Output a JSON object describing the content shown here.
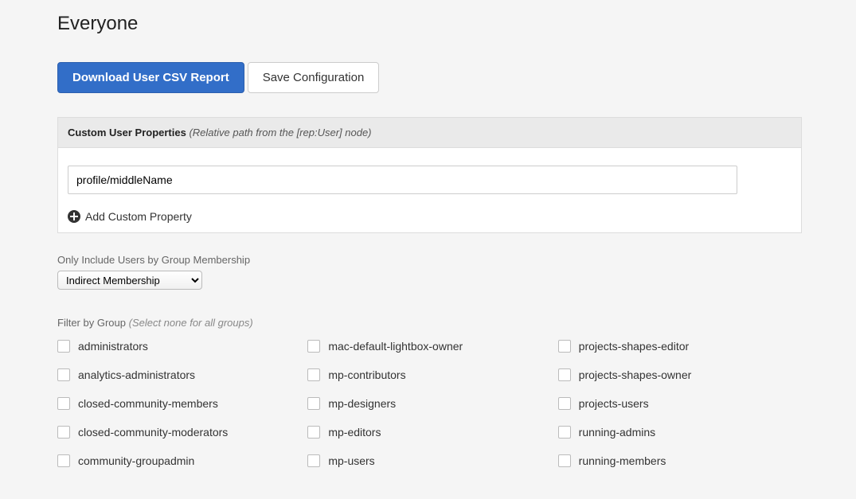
{
  "title": "Everyone",
  "buttons": {
    "download": "Download User CSV Report",
    "save": "Save Configuration"
  },
  "panel": {
    "header_strong": "Custom User Properties",
    "header_hint": "(Relative path from the [rep:User] node)",
    "input_value": "profile/middleName",
    "add_label": "Add Custom Property"
  },
  "membership": {
    "label": "Only Include Users by Group Membership",
    "selected": "Indirect Membership"
  },
  "filter": {
    "label": "Filter by Group",
    "hint": "(Select none for all groups)"
  },
  "groups": {
    "col1": [
      "administrators",
      "analytics-administrators",
      "closed-community-members",
      "closed-community-moderators",
      "community-groupadmin"
    ],
    "col2": [
      "mac-default-lightbox-owner",
      "mp-contributors",
      "mp-designers",
      "mp-editors",
      "mp-users"
    ],
    "col3": [
      "projects-shapes-editor",
      "projects-shapes-owner",
      "projects-users",
      "running-admins",
      "running-members"
    ]
  }
}
